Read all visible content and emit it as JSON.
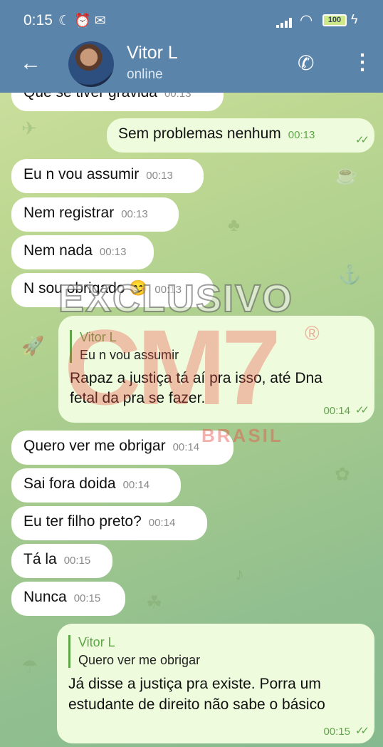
{
  "status_bar": {
    "time": "0:15",
    "battery": "100"
  },
  "header": {
    "back": "←",
    "name": "Vitor L",
    "status": "online",
    "call": "✆",
    "menu": "⋮"
  },
  "messages": [
    {
      "dir": "in",
      "text": "Que se tiver gravida",
      "time": "00:13"
    },
    {
      "dir": "out",
      "text": "Sem problemas nenhum",
      "time": "00:13"
    },
    {
      "dir": "in",
      "text": "Eu n vou assumir",
      "time": "00:13"
    },
    {
      "dir": "in",
      "text": "Nem registrar",
      "time": "00:13"
    },
    {
      "dir": "in",
      "text": "Nem nada",
      "time": "00:13"
    },
    {
      "dir": "in",
      "text": "N sou obrigado 😊",
      "time": "00:13"
    },
    {
      "dir": "out",
      "reply_name": "Vitor L",
      "reply_text": "Eu n vou assumir",
      "line1": "Rapaz a justiça tá aí pra isso, até  Dna",
      "line2": "fetal da pra se fazer.",
      "time": "00:14"
    },
    {
      "dir": "in",
      "text": "Quero ver me obrigar",
      "time": "00:14"
    },
    {
      "dir": "in",
      "text": "Sai fora doida",
      "time": "00:14"
    },
    {
      "dir": "in",
      "text": "Eu ter filho preto?",
      "time": "00:14"
    },
    {
      "dir": "in",
      "text": "Tá la",
      "time": "00:15"
    },
    {
      "dir": "in",
      "text": "Nunca",
      "time": "00:15"
    },
    {
      "dir": "out",
      "reply_name": "Vitor L",
      "reply_text": "Quero ver me obrigar",
      "line1": "Já disse a justiça pra existe. Porra um",
      "line2": "estudante de direito não sabe o básico",
      "time": "00:15"
    }
  ],
  "watermark": {
    "top": "EXCLUSIVO",
    "logo": "CM7",
    "reg": "®",
    "bottom": "BRASIL"
  },
  "colors": {
    "header": "#5b84aa",
    "incoming": "#ffffff",
    "outgoing": "#eefcdd",
    "accent": "#5fa648"
  }
}
